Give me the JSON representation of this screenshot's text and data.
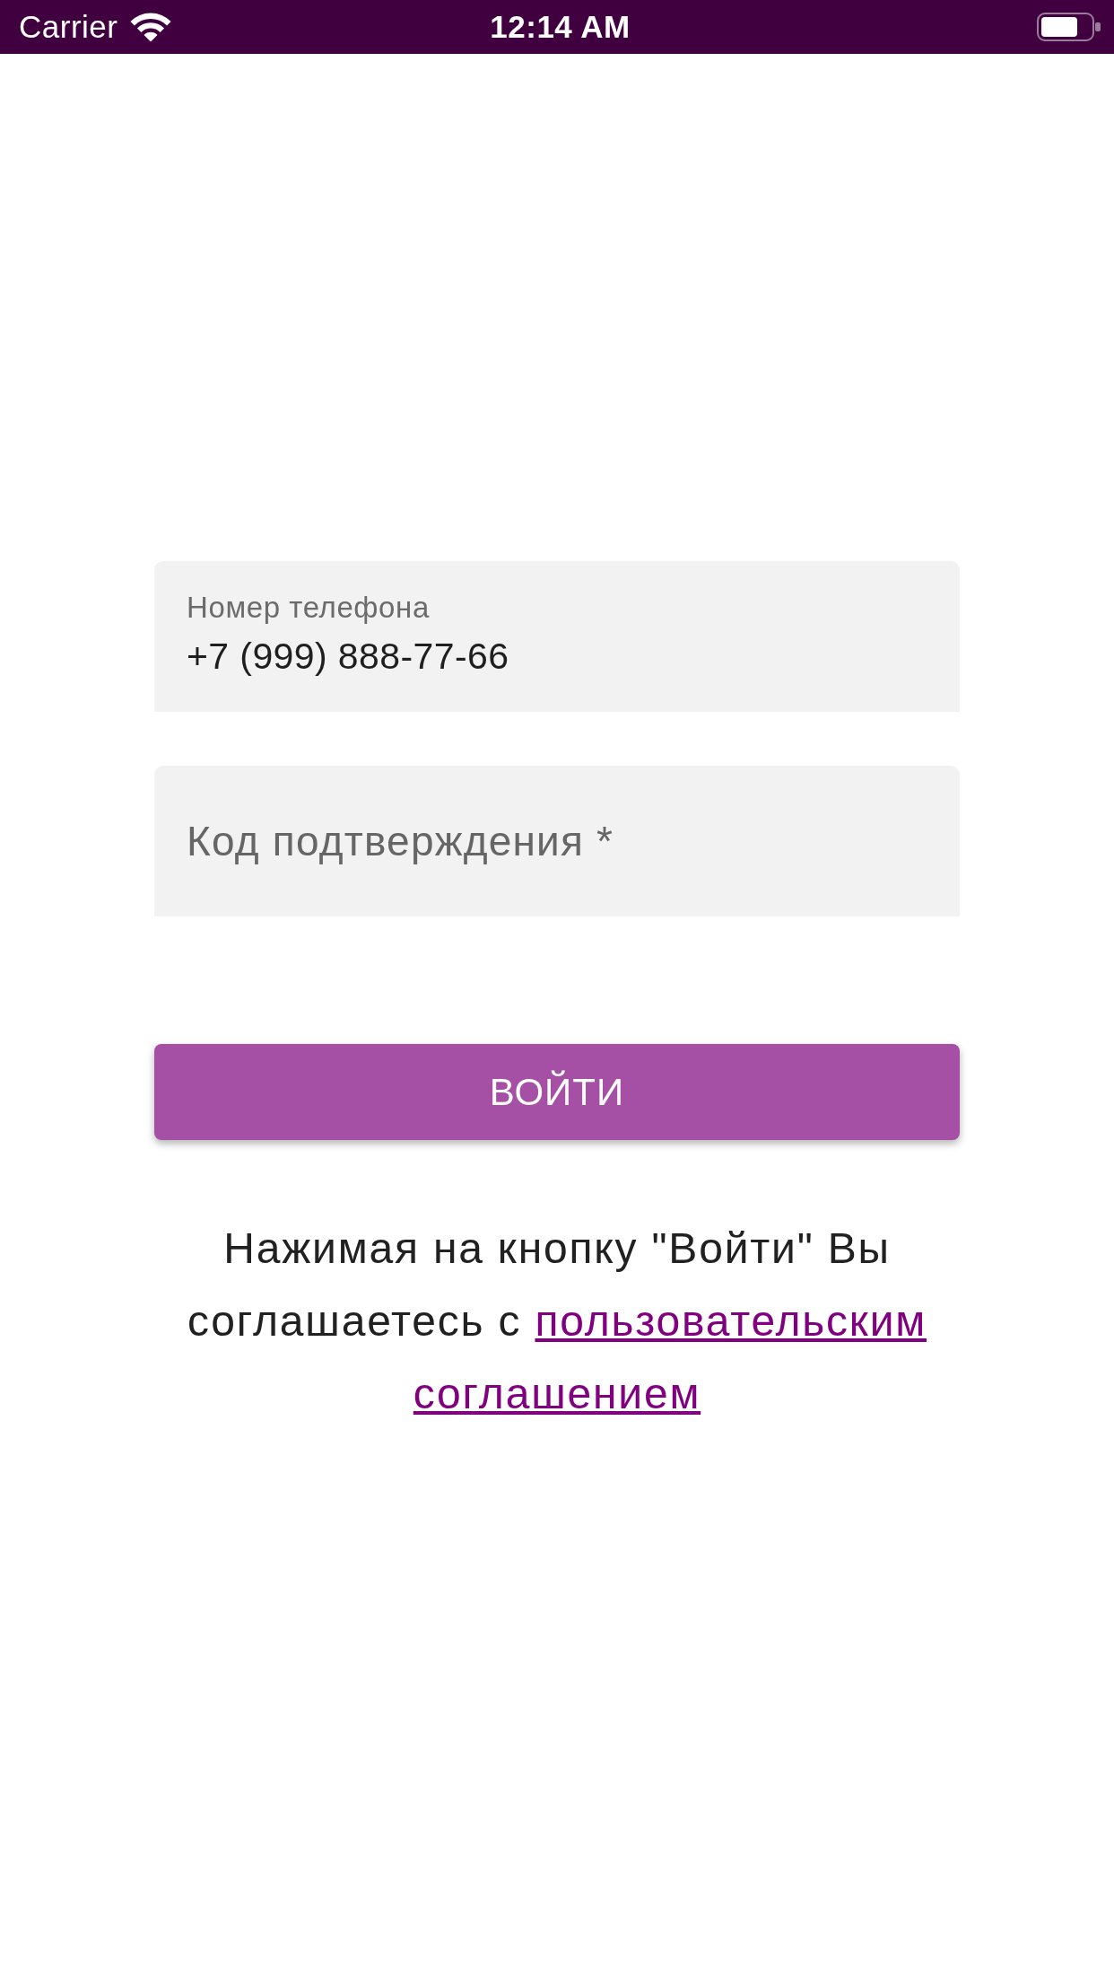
{
  "status_bar": {
    "carrier": "Carrier",
    "time": "12:14 AM"
  },
  "phone_field": {
    "label": "Номер телефона",
    "value": "+7 (999) 888-77-66"
  },
  "code_field": {
    "placeholder": "Код подтверждения *"
  },
  "login_button": {
    "label": "ВОЙТИ"
  },
  "agreement": {
    "text": "Нажимая на кнопку \"Войти\" Вы соглашаетесь с",
    "link": "пользовательским соглашением"
  }
}
